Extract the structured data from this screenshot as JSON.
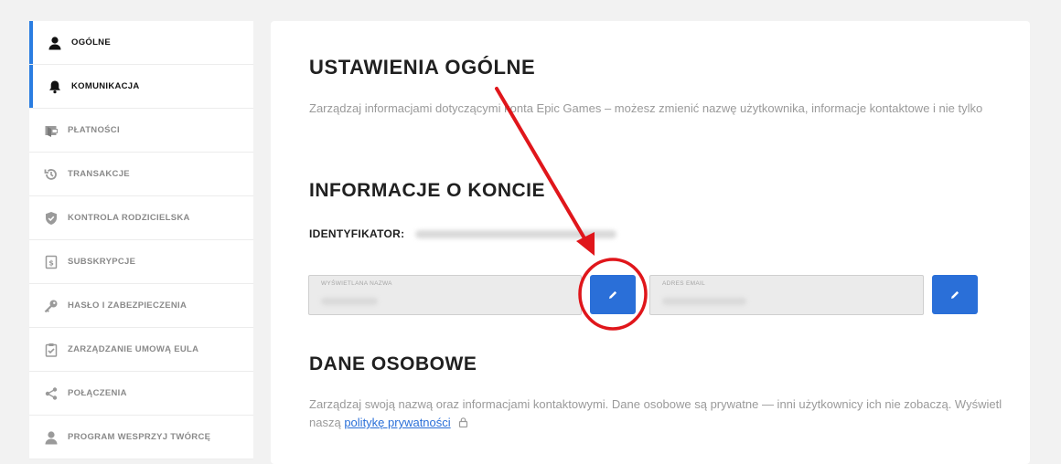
{
  "sidebar": {
    "items": [
      {
        "label": "OGÓLNE",
        "icon": "user-icon",
        "active": true
      },
      {
        "label": "KOMUNIKACJA",
        "icon": "bell-icon",
        "active": true
      },
      {
        "label": "PŁATNOŚCI",
        "icon": "wallet-icon",
        "active": false
      },
      {
        "label": "TRANSAKCJE",
        "icon": "history-icon",
        "active": false
      },
      {
        "label": "KONTROLA RODZICIELSKA",
        "icon": "shield-icon",
        "active": false
      },
      {
        "label": "SUBSKRYPCJE",
        "icon": "receipt-icon",
        "active": false
      },
      {
        "label": "HASŁO I ZABEZPIECZENIA",
        "icon": "key-icon",
        "active": false
      },
      {
        "label": "ZARZĄDZANIE UMOWĄ EULA",
        "icon": "clipboard-check-icon",
        "active": false
      },
      {
        "label": "POŁĄCZENIA",
        "icon": "share-icon",
        "active": false
      },
      {
        "label": "PROGRAM WESPRZYJ TWÓRCĘ",
        "icon": "user-icon",
        "active": false
      }
    ]
  },
  "main": {
    "title": "USTAWIENIA OGÓLNE",
    "description": "Zarządzaj informacjami dotyczącymi konta Epic Games – możesz zmienić nazwę użytkownika, informacje kontaktowe i nie tylko",
    "account_section_title": "INFORMACJE O KONCIE",
    "id_label": "IDENTYFIKATOR:",
    "display_name_label": "WYŚWIETLANA NAZWA",
    "email_label": "ADRES EMAIL",
    "personal_section_title": "DANE OSOBOWE",
    "personal_description": "Zarządzaj swoją nazwą oraz informacjami kontaktowymi. Dane osobowe są prywatne — inni użytkownicy ich nie zobaczą. Wyświetl naszą",
    "privacy_link": "politykę prywatności"
  },
  "colors": {
    "accent": "#2a6fd8",
    "annotation": "#e0161b"
  }
}
